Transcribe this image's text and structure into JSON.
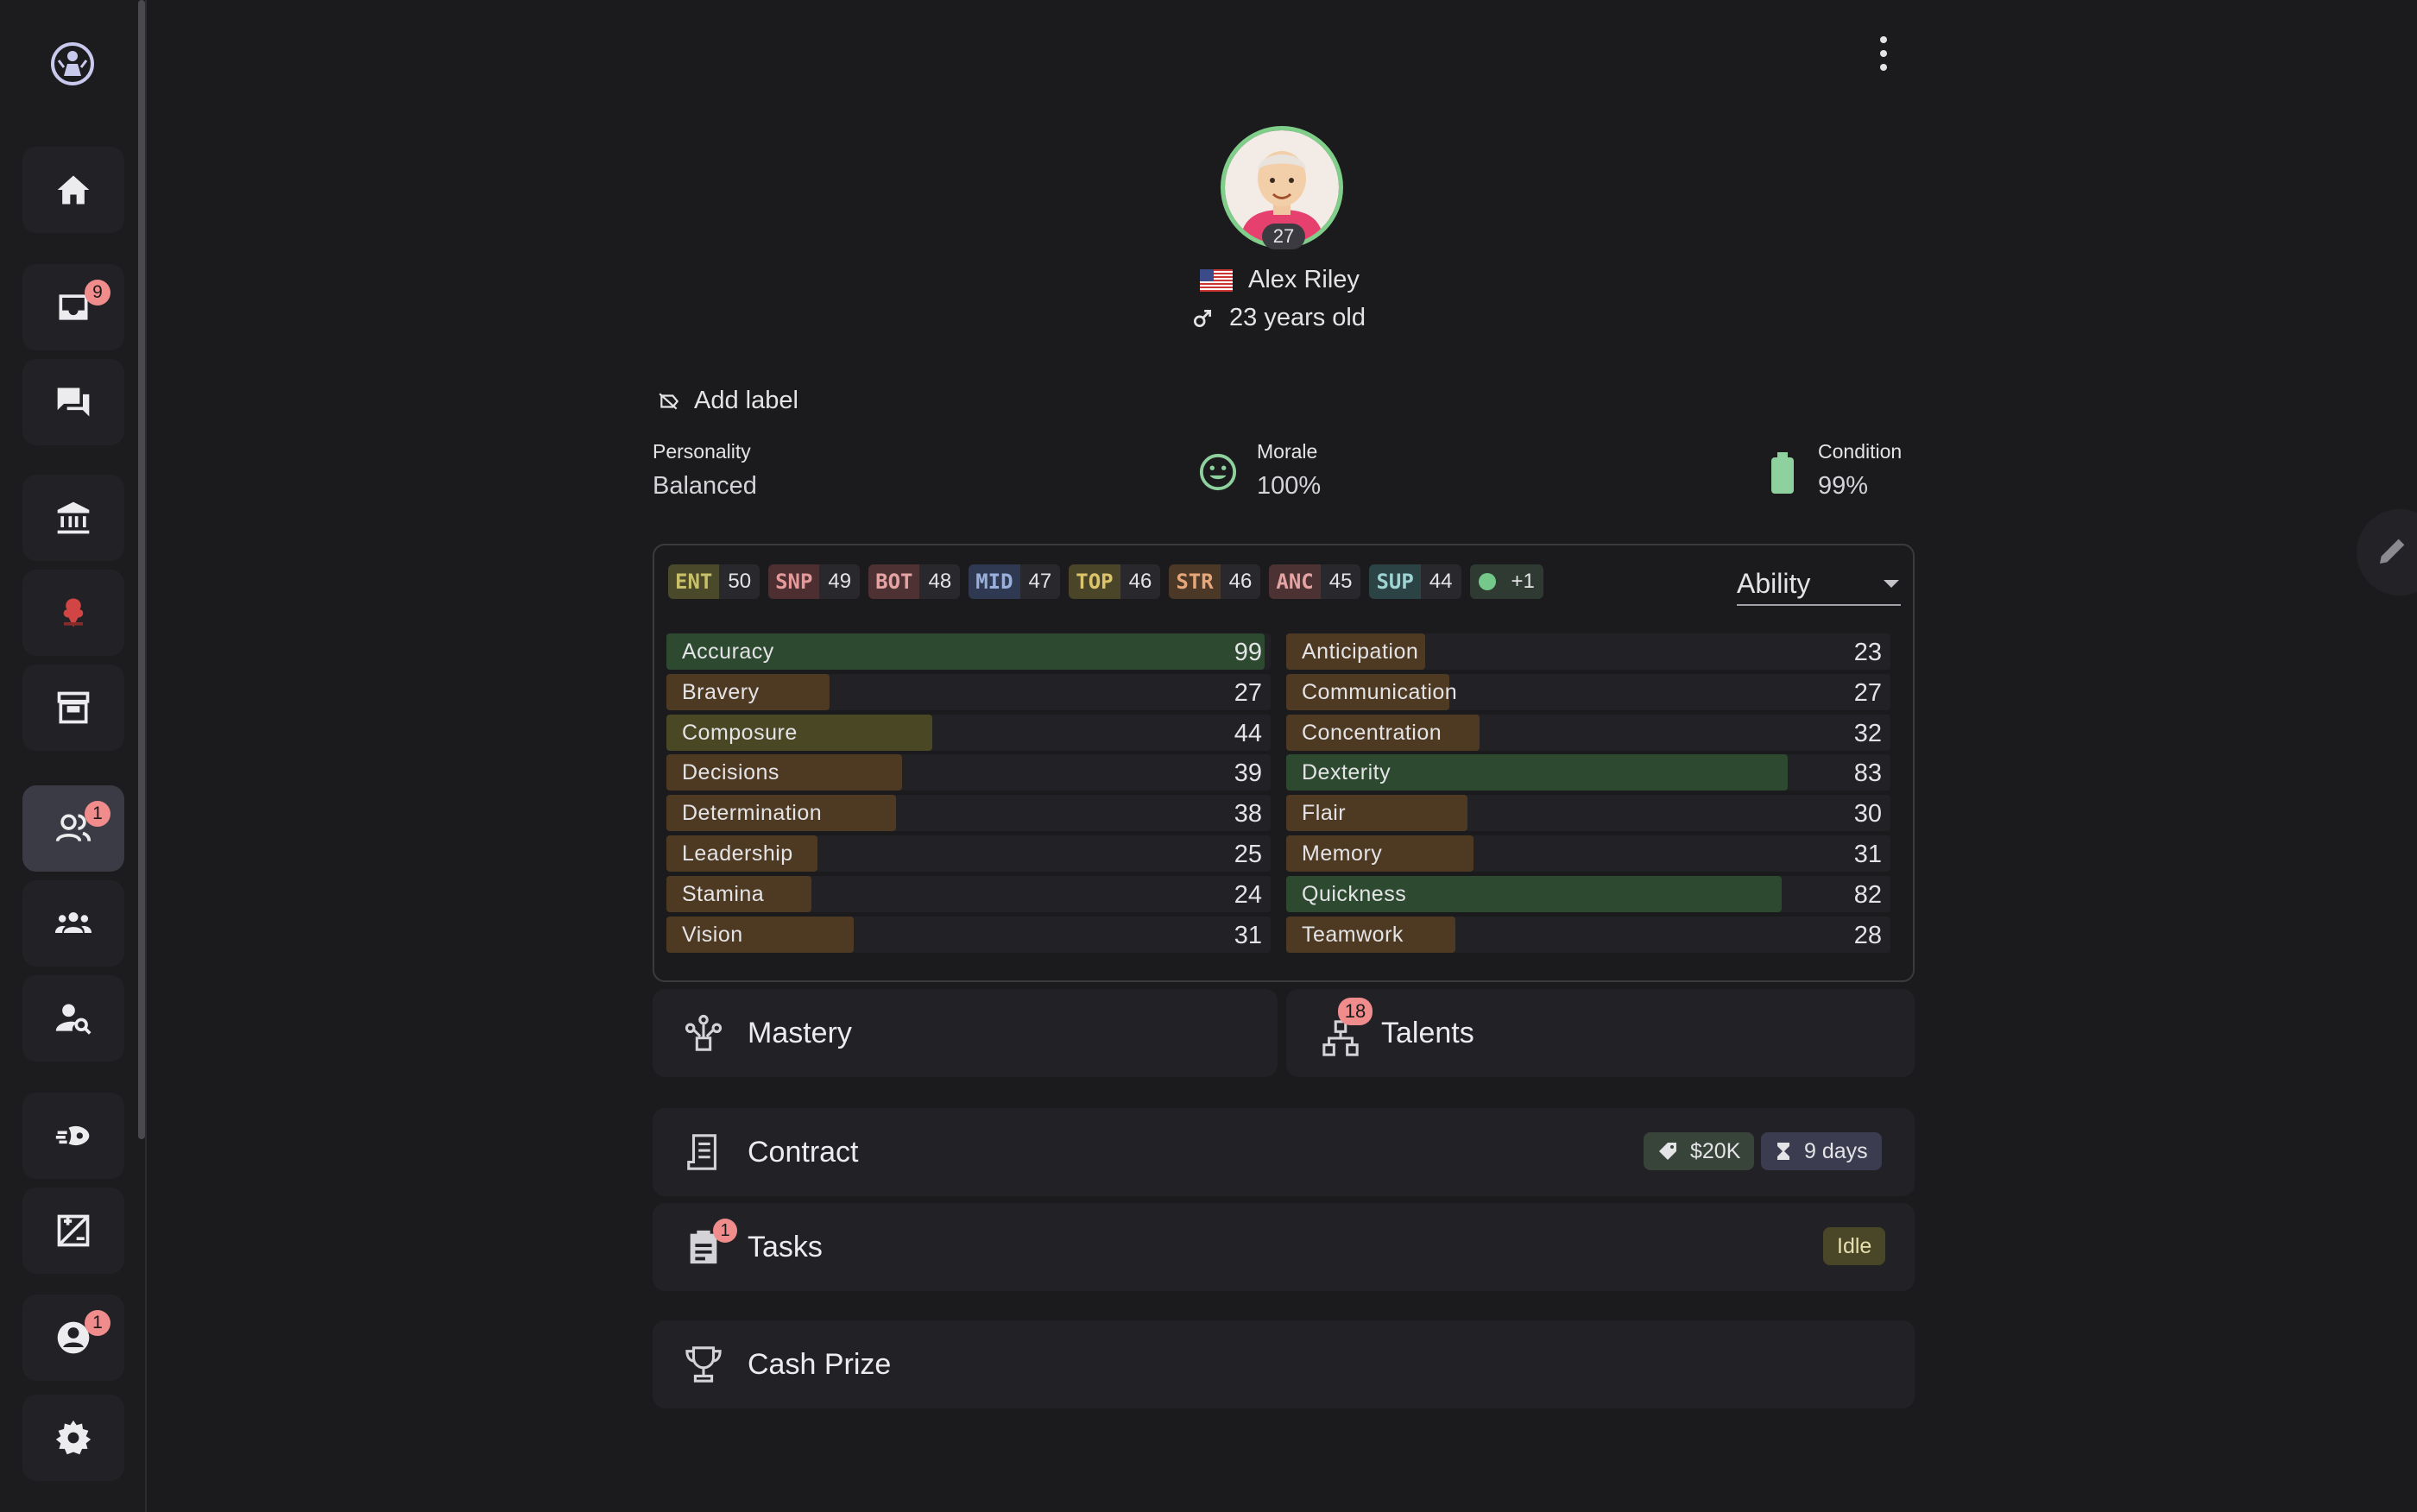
{
  "sidebar": {
    "logo": "app-logo",
    "items": [
      {
        "name": "home",
        "icon": "home-icon"
      },
      {
        "name": "inbox",
        "icon": "inbox-icon",
        "badge": "9"
      },
      {
        "name": "chat",
        "icon": "chat-icon"
      },
      {
        "name": "bank",
        "icon": "bank-icon"
      },
      {
        "name": "team-logo",
        "icon": "team-logo-icon"
      },
      {
        "name": "archive",
        "icon": "archive-icon"
      },
      {
        "name": "players",
        "icon": "players-icon",
        "badge": "1"
      },
      {
        "name": "group",
        "icon": "group-icon"
      },
      {
        "name": "scout",
        "icon": "person-search-icon"
      },
      {
        "name": "training",
        "icon": "training-icon"
      },
      {
        "name": "stats",
        "icon": "stats-icon"
      },
      {
        "name": "profile",
        "icon": "profile-icon",
        "badge": "1"
      },
      {
        "name": "settings",
        "icon": "settings-icon"
      }
    ]
  },
  "player": {
    "level": "27",
    "name": "Alex Riley",
    "age": "23 years old",
    "country_flag": "us-flag-icon",
    "avatar_ring_color": "#7fcf8a"
  },
  "add_label": "Add label",
  "personality": {
    "title": "Personality",
    "value": "Balanced"
  },
  "morale": {
    "title": "Morale",
    "value": "100%"
  },
  "condition": {
    "title": "Condition",
    "value": "99%"
  },
  "role_chips": [
    {
      "key": "ENT",
      "value": "50",
      "color": "#c9c16a",
      "bg": "#4a4a2a"
    },
    {
      "key": "SNP",
      "value": "49",
      "color": "#e49a9a",
      "bg": "#4e2f31"
    },
    {
      "key": "BOT",
      "value": "48",
      "color": "#e4a4a4",
      "bg": "#4e3132"
    },
    {
      "key": "MID",
      "value": "47",
      "color": "#9ab0dc",
      "bg": "#2f3a52"
    },
    {
      "key": "TOP",
      "value": "46",
      "color": "#dcc46a",
      "bg": "#4a4428"
    },
    {
      "key": "STR",
      "value": "46",
      "color": "#e6a87a",
      "bg": "#4c3826"
    },
    {
      "key": "ANC",
      "value": "45",
      "color": "#e4a4a4",
      "bg": "#4c3232"
    },
    {
      "key": "SUP",
      "value": "44",
      "color": "#9fd4d4",
      "bg": "#2b4344"
    }
  ],
  "extra_chip": "+1",
  "ability_select": "Ability",
  "attributes_left": [
    {
      "label": "Accuracy",
      "value": 99
    },
    {
      "label": "Bravery",
      "value": 27
    },
    {
      "label": "Composure",
      "value": 44
    },
    {
      "label": "Decisions",
      "value": 39
    },
    {
      "label": "Determination",
      "value": 38
    },
    {
      "label": "Leadership",
      "value": 25
    },
    {
      "label": "Stamina",
      "value": 24
    },
    {
      "label": "Vision",
      "value": 31
    }
  ],
  "attributes_right": [
    {
      "label": "Anticipation",
      "value": 23
    },
    {
      "label": "Communication",
      "value": 27
    },
    {
      "label": "Concentration",
      "value": 32
    },
    {
      "label": "Dexterity",
      "value": 83
    },
    {
      "label": "Flair",
      "value": 30
    },
    {
      "label": "Memory",
      "value": 31
    },
    {
      "label": "Quickness",
      "value": 82
    },
    {
      "label": "Teamwork",
      "value": 28
    }
  ],
  "mastery": {
    "title": "Mastery"
  },
  "talents": {
    "title": "Talents",
    "badge": "18"
  },
  "contract": {
    "title": "Contract",
    "price": "$20K",
    "duration": "9 days"
  },
  "tasks": {
    "title": "Tasks",
    "badge": "1",
    "status": "Idle"
  },
  "cash_prize": {
    "title": "Cash Prize"
  }
}
